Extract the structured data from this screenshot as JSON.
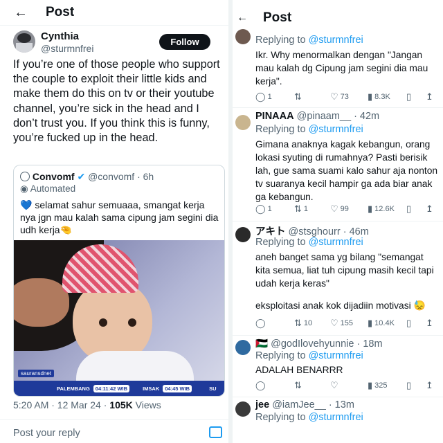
{
  "left": {
    "header": {
      "back_icon": "arrow-left-icon",
      "title": "Post"
    },
    "author": {
      "name": "Cynthia",
      "handle": "@sturmnfrei",
      "follow_label": "Follow"
    },
    "text": "If you’re one of those people who support the couple to exploit their little kids and make them do this on tv or their youtube channel, you’re sick in the head and I don’t trust you. If you think this is funny, you’re fucked up in the head.",
    "quote": {
      "name": "Convomf",
      "verified_icon": "verified-badge-icon",
      "handle": "@convomf",
      "time": "· 6h",
      "automated_label": "Automated",
      "text": "selamat sahur semuaaa, smangat kerja nya jgn mau kalah sama cipung jam segini dia udh kerja",
      "heart_emoji": "💙",
      "pinch_emoji": "🤏",
      "media": {
        "channel_logo": "sauransdnet",
        "city": "PALEMBANG",
        "city_time": "04:11:42 WIB",
        "label": "IMSAK",
        "label_time": "04:45 WIB",
        "trail": "SU"
      }
    },
    "meta": {
      "time": "5:20 AM · 12 Mar 24 ·",
      "views_count": "105K",
      "views_label": "Views"
    },
    "reply_placeholder": "Post your reply",
    "camera_icon": "camera-icon"
  },
  "right": {
    "header": {
      "back_icon": "arrow-left-icon",
      "title": "Post"
    },
    "replies": [
      {
        "replying_prefix": "Replying to",
        "replying_handle": "@sturmnfrei",
        "text": "Ikr. Why menormalkan dengan \"Jangan mau kalah dg Cipung jam segini dia mau kerja\".",
        "replies": "1",
        "retweets": "",
        "likes": "73",
        "views": "8.3K"
      },
      {
        "name": "PINAAA",
        "handle": "@pinaam__",
        "time": "· 42m",
        "replying_prefix": "Replying to",
        "replying_handle": "@sturmnfrei",
        "text": "Gimana anaknya kagak kebangun, orang lokasi syuting di rumahnya? Pasti berisik lah, gue sama suami kalo sahur aja nonton tv suaranya kecil hampir ga ada biar anak ga kebangun.",
        "replies": "1",
        "retweets": "1",
        "likes": "99",
        "views": "12.6K"
      },
      {
        "name": "アキト",
        "handle": "@stsghourr",
        "time": "· 46m",
        "replying_prefix": "Replying to",
        "replying_handle": "@sturmnfrei",
        "text": "aneh banget sama yg bilang \"semangat kita semua, liat tuh cipung masih kecil tapi udah kerja keras\"",
        "text2": "eksploitasi anak kok dijadiin motivasi",
        "emoji": "😓",
        "replies": "",
        "retweets": "10",
        "likes": "155",
        "views": "10.4K"
      },
      {
        "name_flag": "🇵🇸",
        "handle": "@godIlovehyunnie",
        "time": "· 18m",
        "replying_prefix": "Replying to",
        "replying_handle": "@sturmnfrei",
        "text": "ADALAH BENARRR",
        "replies": "",
        "retweets": "",
        "likes": "",
        "views": "325"
      },
      {
        "name": "jee",
        "handle": "@iamJee__",
        "time": "· 13m",
        "replying_prefix": "Replying to",
        "replying_handle": "@sturmnfrei"
      }
    ],
    "icons": {
      "reply": "reply-icon",
      "repost": "repost-icon",
      "like": "heart-icon",
      "views": "views-icon",
      "bookmark": "bookmark-icon",
      "share": "share-icon"
    }
  },
  "colors": {
    "accent": "#1d9bf0",
    "text": "#0f1419",
    "muted": "#536471",
    "border": "#eff3f4"
  }
}
